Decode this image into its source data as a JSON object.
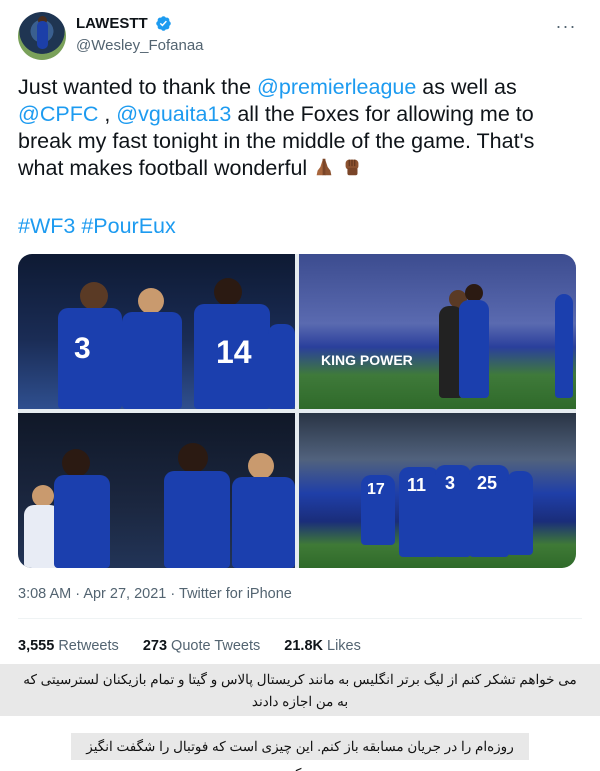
{
  "tweet": {
    "display_name": "LAWESTT",
    "handle": "@Wesley_Fofanaa",
    "more_icon": "more-horizontal-icon",
    "verified_icon": "verified-badge-icon",
    "text": {
      "seg1": "Just wanted to thank the ",
      "mention1": "@premierleague",
      "seg2": " as well as ",
      "mention2": "@CPFC",
      "seg3": " ,  ",
      "mention3": "@vguaita13",
      "seg4": " all the Foxes for allowing me to break my fast tonight in the middle of the game. That's what makes football wonderful "
    },
    "emojis": [
      "folded-hands-icon",
      "raised-fist-icon"
    ],
    "hashtags": [
      "#WF3",
      "#PourEux"
    ],
    "photos": [
      {
        "numbers": [
          "3",
          "14"
        ],
        "label": "players-celebrating-photo"
      },
      {
        "banner": "KING POWER",
        "label": "players-embracing-photo"
      },
      {
        "numbers": [],
        "label": "players-high-five-photo"
      },
      {
        "numbers": [
          "17",
          "11",
          "3",
          "25"
        ],
        "label": "team-huddle-photo"
      }
    ],
    "time": "3:08 AM",
    "date": "Apr 27, 2021",
    "separator": "·",
    "source": "Twitter for iPhone",
    "stats": {
      "retweets_count": "3,555",
      "retweets_label": "Retweets",
      "quotes_count": "273",
      "quotes_label": "Quote Tweets",
      "likes_count": "21.8K",
      "likes_label": "Likes"
    }
  },
  "captions": {
    "line1": "می خواهم تشکر کنم از لیگ برتر انگلیس به مانند کریستال پالاس و گیتا و تمام بازیکنان لسترسیتی که به من اجازه دادند",
    "line2": "روزه‌ام را در جریان مسابقه باز کنم. این چیزی است که فوتبال را شگفت انگیز می‌کند."
  },
  "colors": {
    "link": "#1d9bf0",
    "text": "#0f1419",
    "muted": "#536471",
    "caption_bg": "#e8e8e8"
  }
}
